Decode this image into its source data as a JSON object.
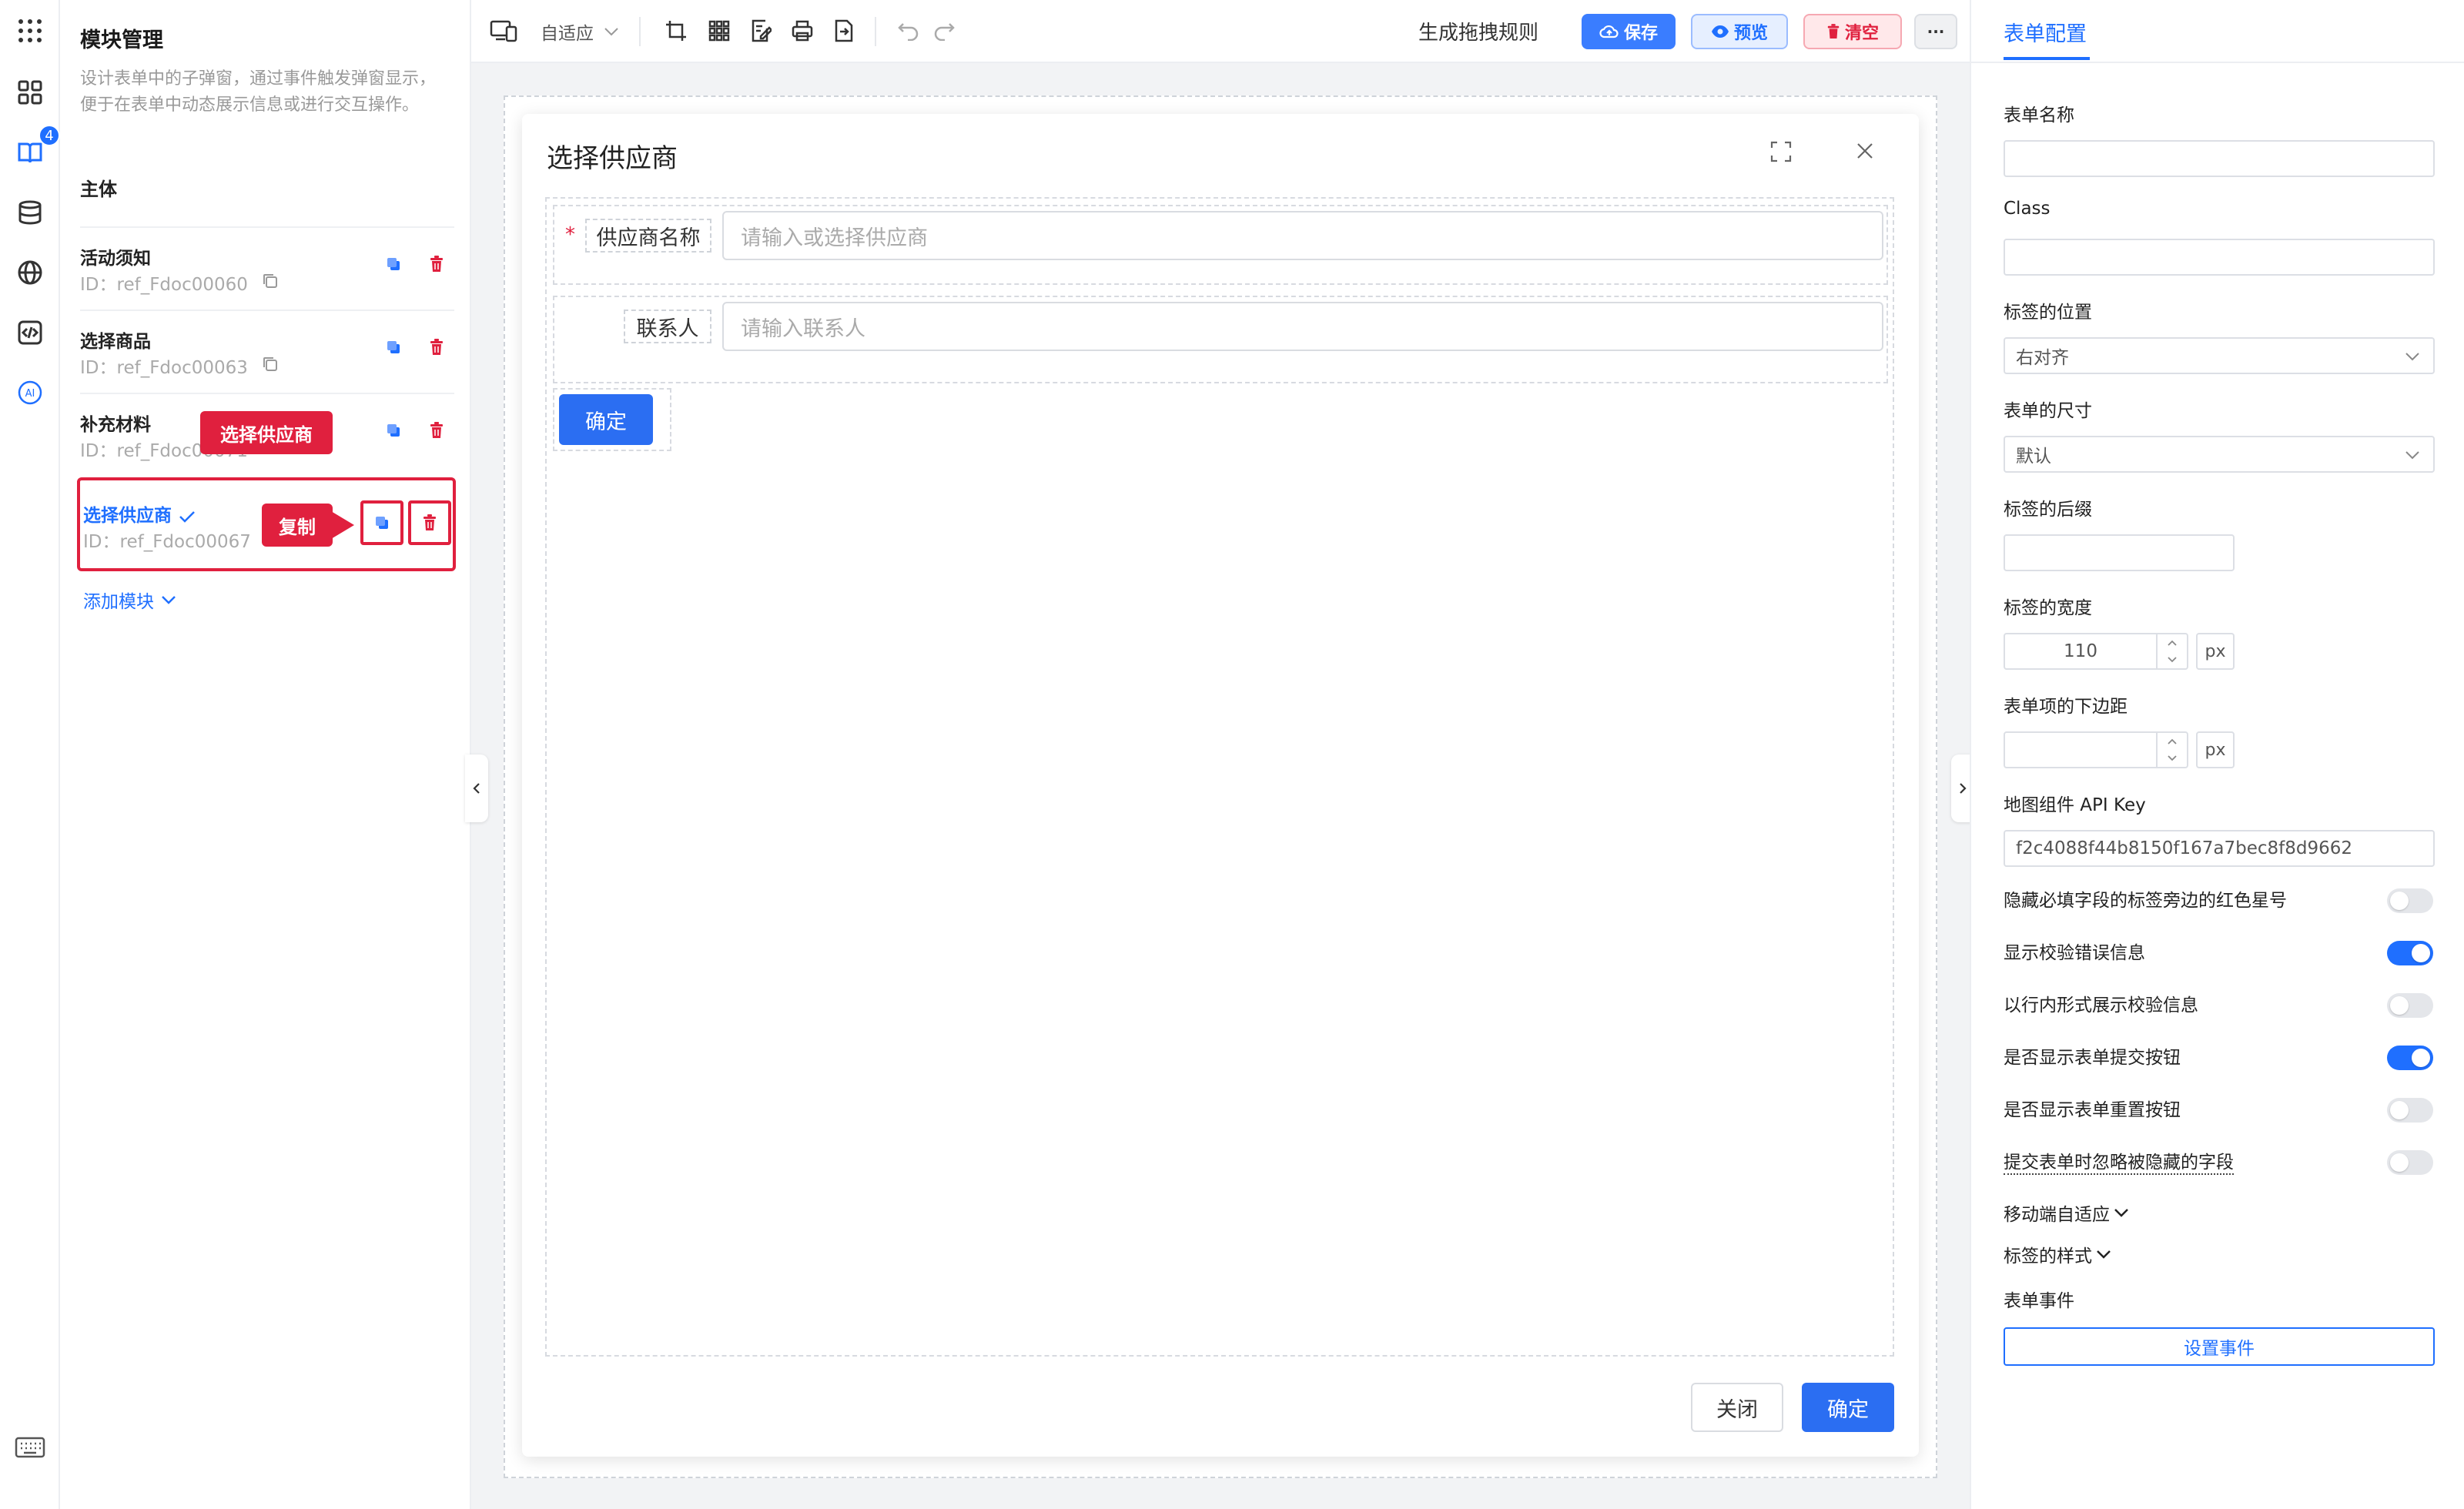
{
  "colors": {
    "primary": "#1f6fff",
    "danger": "#e0203e",
    "preview_bg": "#e6efff",
    "clear_bg": "#ffe8ea"
  },
  "rail": {
    "icons": [
      "grid-dots-icon",
      "apps-icon",
      "book-icon",
      "database-icon",
      "globe-icon",
      "code-icon",
      "ai-icon",
      "keyboard-icon"
    ],
    "badge": "4"
  },
  "module_panel": {
    "title": "模块管理",
    "description": "设计表单中的子弹窗，通过事件触发弹窗显示，便于在表单中动态展示信息或进行交互操作。",
    "section": "主体",
    "modules": [
      {
        "name": "活动须知",
        "id": "ID：ref_Fdoc00060"
      },
      {
        "name": "选择商品",
        "id": "ID：ref_Fdoc00063"
      },
      {
        "name": "补充材料",
        "id": "ID：ref_Fdoc00071"
      },
      {
        "name": "选择供应商",
        "id": "ID：ref_Fdoc00067"
      }
    ],
    "add_module": "添加模块",
    "annotations": {
      "tooltip": "选择供应商",
      "copy": "复制",
      "delete": "删除"
    }
  },
  "toolbar": {
    "device": "自适应",
    "generate": "生成拖拽规则",
    "save": "保存",
    "preview": "预览",
    "clear": "清空",
    "more": "···"
  },
  "modal": {
    "title": "选择供应商",
    "fields": [
      {
        "label": "供应商名称",
        "required": "*",
        "placeholder": "请输入或选择供应商"
      },
      {
        "label": "联系人",
        "placeholder": "请输入联系人"
      }
    ],
    "submit": "确定",
    "footer_close": "关闭",
    "footer_ok": "确定"
  },
  "config": {
    "tab": "表单配置",
    "form_name_label": "表单名称",
    "form_name_value": "",
    "class_label": "Class",
    "class_value": "",
    "label_position_label": "标签的位置",
    "label_position_value": "右对齐",
    "form_size_label": "表单的尺寸",
    "form_size_value": "默认",
    "label_suffix_label": "标签的后缀",
    "label_suffix_value": "",
    "label_width_label": "标签的宽度",
    "label_width_value": "110",
    "label_width_unit": "px",
    "item_margin_label": "表单项的下边距",
    "item_margin_value": "",
    "item_margin_unit": "px",
    "map_key_label": "地图组件 API Key",
    "map_key_value": "f2c4088f44b8150f167a7bec8f8d9662",
    "toggles": [
      {
        "label": "隐藏必填字段的标签旁边的红色星号",
        "on": false
      },
      {
        "label": "显示校验错误信息",
        "on": true
      },
      {
        "label": "以行内形式展示校验信息",
        "on": false
      },
      {
        "label": "是否显示表单提交按钮",
        "on": true
      },
      {
        "label": "是否显示表单重置按钮",
        "on": false
      },
      {
        "label": "提交表单时忽略被隐藏的字段",
        "on": false
      }
    ],
    "mobile_adaptive": "移动端自适应",
    "label_style": "标签的样式",
    "form_events": "表单事件",
    "set_events": "设置事件"
  }
}
